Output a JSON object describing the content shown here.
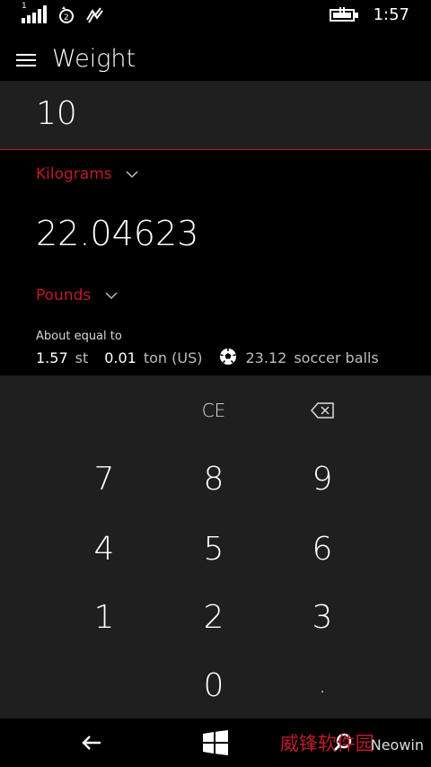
{
  "status": {
    "signal_index": "1",
    "time": "1:57"
  },
  "header": {
    "title": "Weight"
  },
  "converter": {
    "input_value": "10",
    "from_unit": "Kilograms",
    "output_value": "22.04623",
    "to_unit": "Pounds",
    "about_label": "About equal to",
    "equivalents": [
      {
        "value": "1.57",
        "unit": "st"
      },
      {
        "value": "0.01",
        "unit": "ton (US)"
      },
      {
        "value": "23.12",
        "unit": "soccer balls",
        "icon": "soccer-ball-icon"
      }
    ]
  },
  "keypad": {
    "clear_label": "CE",
    "backspace_icon": "backspace-icon",
    "keys": [
      "7",
      "8",
      "9",
      "4",
      "5",
      "6",
      "1",
      "2",
      "3",
      "0",
      "."
    ]
  },
  "navbar": {
    "back_icon": "back-arrow-icon",
    "home_icon": "windows-logo-icon",
    "search_icon": "search-icon"
  },
  "watermark": {
    "cn_text": "威锋软件园",
    "en_text": "Neowin"
  },
  "colors": {
    "accent": "#c0192b",
    "keypad_bg": "#1f1f1f",
    "background": "#000000"
  }
}
